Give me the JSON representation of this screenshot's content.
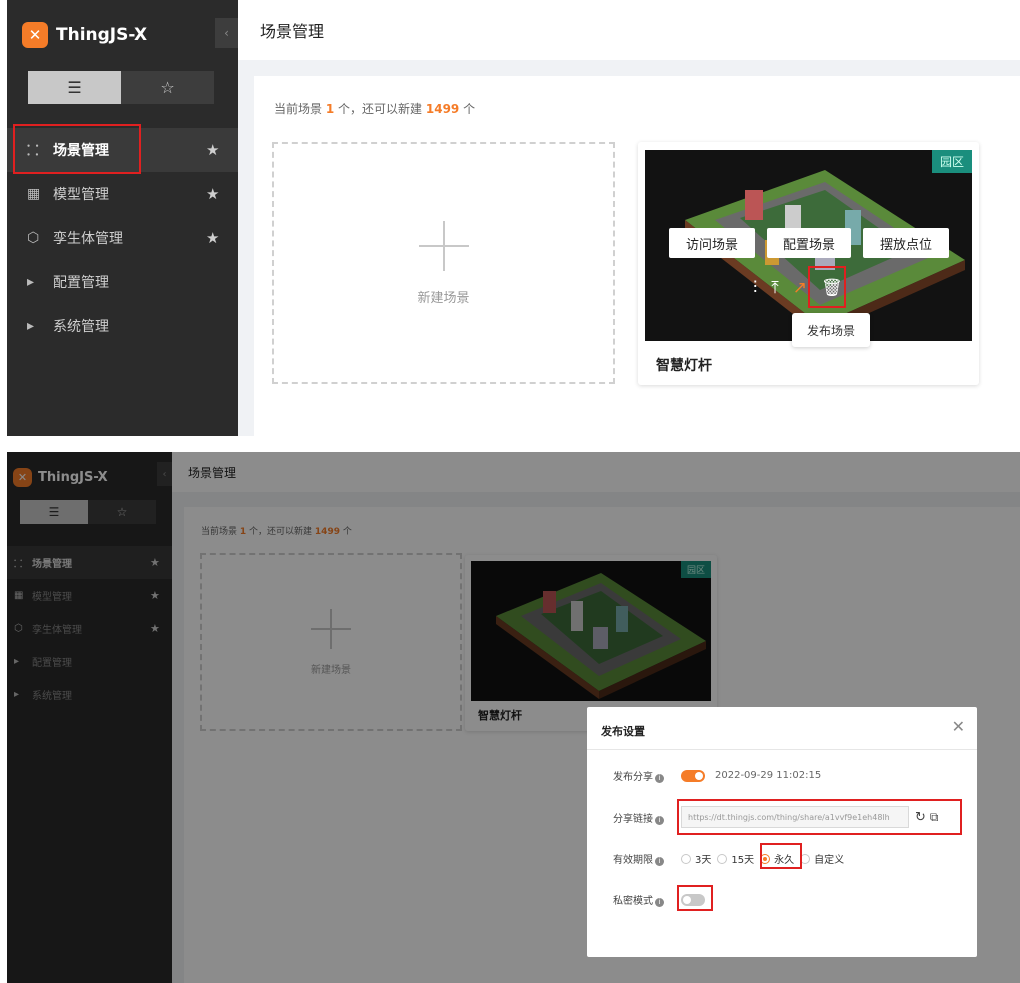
{
  "app": {
    "logo_text": "ThingJS-X",
    "logo_badge": "✕",
    "collapse_icon": "‹",
    "brand_color": "#f57c28",
    "highlight_color": "#e02020"
  },
  "sidebar": {
    "list_view_icon": "☰",
    "star_view_icon": "☆",
    "items": [
      {
        "icon": "⸬",
        "label": "场景管理",
        "starred": true,
        "active": true
      },
      {
        "icon": "▦",
        "label": "模型管理",
        "starred": true,
        "active": false
      },
      {
        "icon": "⬡",
        "label": "孪生体管理",
        "starred": true,
        "active": false
      },
      {
        "icon": "▸",
        "label": "配置管理",
        "starred": false,
        "active": false
      },
      {
        "icon": "▸",
        "label": "系统管理",
        "starred": false,
        "active": false
      }
    ]
  },
  "header": {
    "title": "场景管理"
  },
  "summary": {
    "prefix": "当前场景",
    "current": "1",
    "middle": "个，还可以新建",
    "remaining": "1499",
    "suffix": "个"
  },
  "new_scene": {
    "label": "新建场景"
  },
  "scene_card": {
    "name": "智慧灯杆",
    "tag": "园区",
    "actions": [
      "访问场景",
      "配置场景",
      "摆放点位"
    ],
    "icons": [
      "sliders-icon",
      "pin-top-icon",
      "publish-icon",
      "delete-icon"
    ],
    "tooltip": "发布场景"
  },
  "publish_dialog": {
    "title": "发布设置",
    "close": "✕",
    "share_label": "发布分享",
    "share_on": true,
    "share_time": "2022-09-29 11:02:15",
    "link_label": "分享链接",
    "link_value": "https://dt.thingjs.com/thing/share/a1vvf9e1eh48lh",
    "validity_label": "有效期限",
    "validity_options": [
      "3天",
      "15天",
      "永久",
      "自定义"
    ],
    "validity_selected": "永久",
    "private_label": "私密模式",
    "private_on": false
  }
}
